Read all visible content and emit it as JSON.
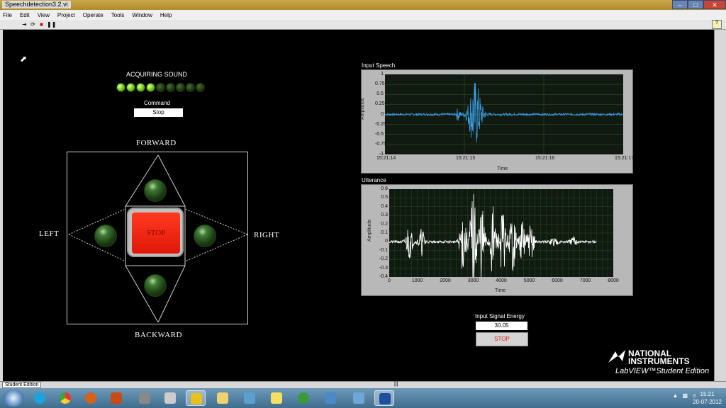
{
  "window": {
    "title": "Speechdetection3.2.vi"
  },
  "menu": [
    "File",
    "Edit",
    "View",
    "Project",
    "Operate",
    "Tools",
    "Window",
    "Help"
  ],
  "indicators": {
    "acquiring_label": "ACQUIRING SOUND",
    "leds_on": 4,
    "leds_total": 9,
    "command_label": "Command",
    "command_value": "Stop"
  },
  "direction_pad": {
    "forward": "FORWARD",
    "backward": "BACKWARD",
    "left": "LEFT",
    "right": "RIGHT",
    "stop_label": "STOP"
  },
  "graphs": {
    "input_speech": {
      "title": "Input Speech",
      "y_label": "Amplitude",
      "x_label": "Time",
      "y_ticks": [
        "1",
        "0.75",
        "0.5",
        "0.25",
        "0",
        "-0.25",
        "-0.5",
        "-0.75",
        "-1"
      ],
      "x_ticks": [
        "15:21:14",
        "15:21:15",
        "15:21:16",
        "15:21:17"
      ]
    },
    "utterance": {
      "title": "Utterance",
      "y_label": "Amplitude",
      "x_label": "Time",
      "y_ticks": [
        "0.6",
        "0.5",
        "0.4",
        "0.3",
        "0.2",
        "0.1",
        "0",
        "-0.1",
        "-0.2",
        "-0.3",
        "-0.4"
      ],
      "x_ticks": [
        "0",
        "1000",
        "2000",
        "3000",
        "4000",
        "5000",
        "6000",
        "7000",
        "8000"
      ]
    }
  },
  "energy": {
    "label": "Input Signal Energy",
    "value": "30.05",
    "stop_label": "STOP"
  },
  "branding": {
    "line1": "NATIONAL",
    "line2": "INSTRUMENTS",
    "line3": "LabVIEW™Student Edition"
  },
  "status_bar": {
    "tag": "Student Edition"
  },
  "clock": {
    "time": "15:21",
    "date": "20-07-2012"
  },
  "colors": {
    "led_on": "#7bd11f",
    "stop_red": "#e01707",
    "waveform_input": "#3a9ee8",
    "waveform_utterance": "#ffffff"
  }
}
